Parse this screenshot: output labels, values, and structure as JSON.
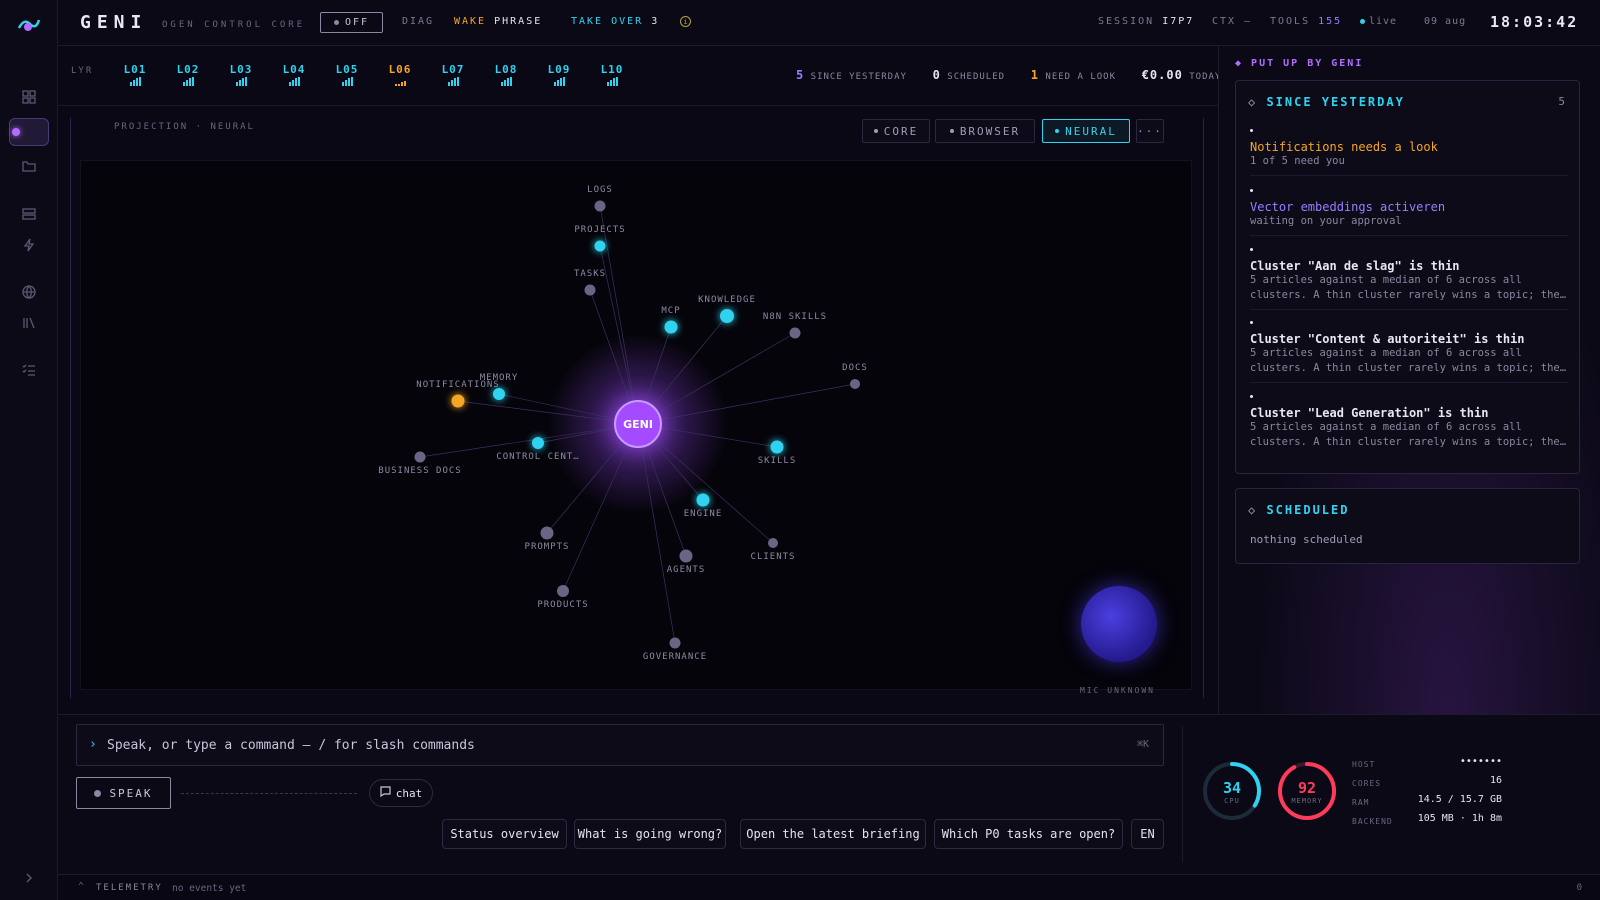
{
  "brand": {
    "name": "GENI",
    "subtitle": "OGEN CONTROL CORE"
  },
  "topbar": {
    "off_button": "OFF",
    "diag": "DIAG",
    "wake": "WAKE",
    "phrase": "PHRASE",
    "take_over": "TAKE OVER",
    "take_over_count": "3",
    "info_glyph": "i",
    "session_label": "SESSION",
    "session_value": "I7P7",
    "ctx": "CTX —",
    "tools_label": "TOOLS",
    "tools_value": "155",
    "live": "live",
    "date": "09 aug",
    "clock": "18:03:42"
  },
  "layers": {
    "label": "LYR",
    "items": [
      "L01",
      "L02",
      "L03",
      "L04",
      "L05",
      "L06",
      "L07",
      "L08",
      "L09",
      "L10"
    ],
    "highlight": "L06"
  },
  "summary": {
    "since_yesterday_count": "5",
    "since_yesterday_label": "SINCE YESTERDAY",
    "scheduled_count": "0",
    "scheduled_label": "SCHEDULED",
    "need_look_count": "1",
    "need_look_label": "NEED A LOOK",
    "cost": "€0.00",
    "cost_label": "TODAY"
  },
  "projection": {
    "label": "PROJECTION · NEURAL",
    "views": [
      "CORE",
      "BROWSER",
      "NEURAL",
      "···"
    ],
    "active_view": "NEURAL",
    "mic_status": "MIC UNKNOWN"
  },
  "graph": {
    "center": "GENI",
    "nodes": [
      {
        "label": "LOGS",
        "color": "#6b6585"
      },
      {
        "label": "PROJECTS",
        "color": "#2fd3f0"
      },
      {
        "label": "TASKS",
        "color": "#6b6585"
      },
      {
        "label": "MCP",
        "color": "#2fd3f0"
      },
      {
        "label": "KNOWLEDGE",
        "color": "#2fd3f0"
      },
      {
        "label": "N8N SKILLS",
        "color": "#6b6585"
      },
      {
        "label": "DOCS",
        "color": "#6b6585"
      },
      {
        "label": "MEMORY",
        "color": "#2fd3f0"
      },
      {
        "label": "NOTIFICATIONS",
        "color": "#f5a623"
      },
      {
        "label": "CONTROL CENT…",
        "color": "#2fd3f0"
      },
      {
        "label": "BUSINESS DOCS",
        "color": "#6b6585"
      },
      {
        "label": "SKILLS",
        "color": "#2fd3f0"
      },
      {
        "label": "ENGINE",
        "color": "#2fd3f0"
      },
      {
        "label": "PROMPTS",
        "color": "#6b6585"
      },
      {
        "label": "AGENTS",
        "color": "#6b6585"
      },
      {
        "label": "CLIENTS",
        "color": "#6b6585"
      },
      {
        "label": "PRODUCTS",
        "color": "#6b6585"
      },
      {
        "label": "GOVERNANCE",
        "color": "#6b6585"
      }
    ]
  },
  "panel": {
    "header": "PUT UP BY GENI",
    "since_title": "SINCE YESTERDAY",
    "since_count": "5",
    "items": [
      {
        "title": "Notifications needs a look",
        "sub": "1 of 5 need you",
        "tone": "warn"
      },
      {
        "title": "Vector embeddings activeren",
        "sub": "waiting on your approval",
        "tone": "accent"
      },
      {
        "title": "Cluster \"Aan de slag\" is thin",
        "sub": "5 articles against a median of 6 across all clusters. A thin cluster rarely wins a topic; the…",
        "tone": "normal"
      },
      {
        "title": "Cluster \"Content & autoriteit\" is thin",
        "sub": "5 articles against a median of 6 across all clusters. A thin cluster rarely wins a topic; the…",
        "tone": "normal"
      },
      {
        "title": "Cluster \"Lead Generation\" is thin",
        "sub": "5 articles against a median of 6 across all clusters. A thin cluster rarely wins a topic; the…",
        "tone": "normal"
      }
    ],
    "scheduled_title": "SCHEDULED",
    "scheduled_empty": "nothing scheduled"
  },
  "command": {
    "placeholder": "Speak, or type a command — / for slash commands",
    "shortcut": "⌘K",
    "speak": "SPEAK",
    "chat": "chat",
    "chips": [
      "Status overview",
      "What is going wrong?",
      "Open the latest briefing",
      "Which P0 tasks are open?",
      "EN"
    ]
  },
  "system": {
    "cpu_value": "34",
    "cpu_label": "CPU",
    "cpu_pct": 34,
    "mem_value": "92",
    "mem_label": "MEMORY",
    "mem_pct": 92,
    "host_label": "HOST",
    "host_value": "•••••••",
    "cores_label": "CORES",
    "cores_value": "16",
    "ram_label": "RAM",
    "ram_value": "14.5 / 15.7 GB",
    "backend_label": "BACKEND",
    "backend_value": "105 MB · 1h 8m"
  },
  "telemetry": {
    "label": "TELEMETRY",
    "status": "no events yet",
    "count": "0"
  },
  "colors": {
    "accent": "#2fd3f0",
    "brand": "#b26dff",
    "warn": "#f5a623",
    "danger": "#ff3b5c",
    "bg": "#0a0814"
  }
}
